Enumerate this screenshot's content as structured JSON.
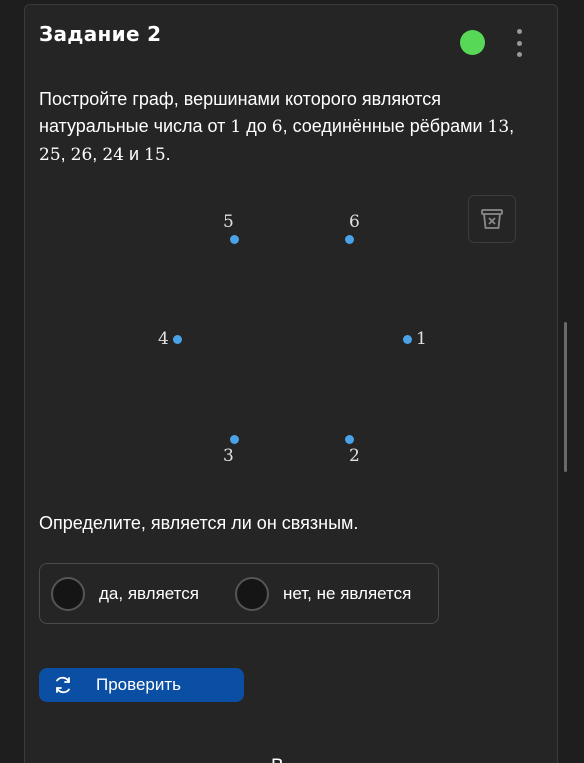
{
  "task": {
    "title": "Задание 2",
    "status_color": "#57d957",
    "menu_icon": "kebab-menu-icon",
    "text_parts": {
      "p1": "Постройте граф, вершинами которого являются натуральные числа от ",
      "n1": "1",
      "p2": " до ",
      "n2": "6",
      "p3": ", соединённые рёбрами ",
      "e1": "13",
      "c1": ", ",
      "e2": "25",
      "c2": ", ",
      "e3": "26",
      "c3": ", ",
      "e4": "24",
      "p4": " и ",
      "e5": "15",
      "p5": "."
    }
  },
  "graph": {
    "vertices": [
      "1",
      "2",
      "3",
      "4",
      "5",
      "6"
    ],
    "clear_icon": "trash-clear-icon",
    "vertex_color": "#4aa3e8"
  },
  "question": {
    "text": "Определите, является ли он связным.",
    "options": [
      {
        "label": "да, является",
        "selected": false
      },
      {
        "label": "нет, не является",
        "selected": false
      }
    ]
  },
  "actions": {
    "check_label": "Проверить",
    "check_icon": "refresh-icon",
    "check_color": "#0a4fa3"
  },
  "footer": {
    "partial_text": "В"
  }
}
